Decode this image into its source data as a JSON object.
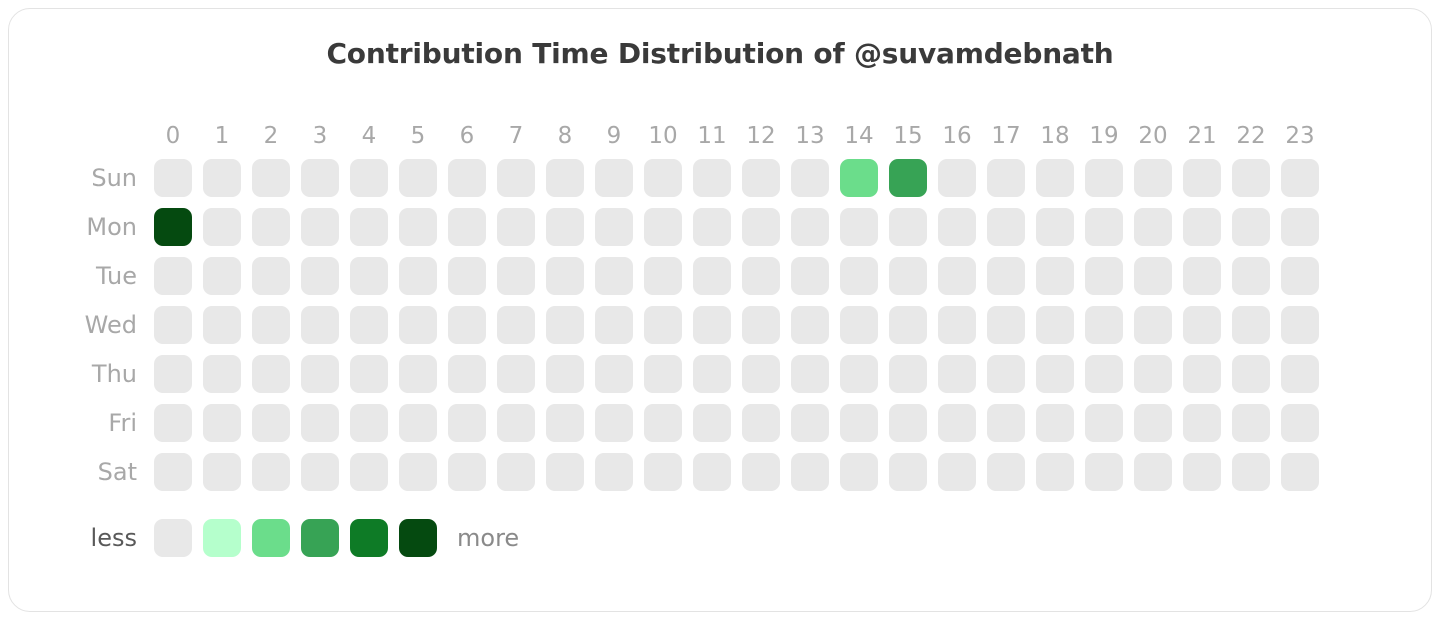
{
  "card": {
    "title": "Contribution Time Distribution of @suvamdebnath"
  },
  "legend": {
    "less_label": "less",
    "more_label": "more"
  },
  "palette": {
    "level0": "#e8e8e8",
    "level1": "#b5ffcc",
    "level2": "#6bdd8b",
    "level3": "#37a355",
    "level4": "#0e7b26",
    "level5": "#054a10"
  },
  "chart_data": {
    "type": "heatmap",
    "title": "Contribution Time Distribution of @suvamdebnath",
    "xlabel": "",
    "ylabel": "",
    "grid": false,
    "legend_position": "bottom-left",
    "legend_labels": [
      "less",
      "more"
    ],
    "legend_levels": [
      0,
      1,
      2,
      3,
      4,
      5
    ],
    "x_tick_labels": [
      "0",
      "1",
      "2",
      "3",
      "4",
      "5",
      "6",
      "7",
      "8",
      "9",
      "10",
      "11",
      "12",
      "13",
      "14",
      "15",
      "16",
      "17",
      "18",
      "19",
      "20",
      "21",
      "22",
      "23"
    ],
    "y_tick_labels": [
      "Sun",
      "Mon",
      "Tue",
      "Wed",
      "Thu",
      "Fri",
      "Sat"
    ],
    "zlim": [
      0,
      5
    ],
    "values": [
      [
        0,
        0,
        0,
        0,
        0,
        0,
        0,
        0,
        0,
        0,
        0,
        0,
        0,
        0,
        2,
        3,
        0,
        0,
        0,
        0,
        0,
        0,
        0,
        0
      ],
      [
        5,
        0,
        0,
        0,
        0,
        0,
        0,
        0,
        0,
        0,
        0,
        0,
        0,
        0,
        0,
        0,
        0,
        0,
        0,
        0,
        0,
        0,
        0,
        0
      ],
      [
        0,
        0,
        0,
        0,
        0,
        0,
        0,
        0,
        0,
        0,
        0,
        0,
        0,
        0,
        0,
        0,
        0,
        0,
        0,
        0,
        0,
        0,
        0,
        0
      ],
      [
        0,
        0,
        0,
        0,
        0,
        0,
        0,
        0,
        0,
        0,
        0,
        0,
        0,
        0,
        0,
        0,
        0,
        0,
        0,
        0,
        0,
        0,
        0,
        0
      ],
      [
        0,
        0,
        0,
        0,
        0,
        0,
        0,
        0,
        0,
        0,
        0,
        0,
        0,
        0,
        0,
        0,
        0,
        0,
        0,
        0,
        0,
        0,
        0,
        0
      ],
      [
        0,
        0,
        0,
        0,
        0,
        0,
        0,
        0,
        0,
        0,
        0,
        0,
        0,
        0,
        0,
        0,
        0,
        0,
        0,
        0,
        0,
        0,
        0,
        0
      ],
      [
        0,
        0,
        0,
        0,
        0,
        0,
        0,
        0,
        0,
        0,
        0,
        0,
        0,
        0,
        0,
        0,
        0,
        0,
        0,
        0,
        0,
        0,
        0,
        0
      ]
    ]
  }
}
